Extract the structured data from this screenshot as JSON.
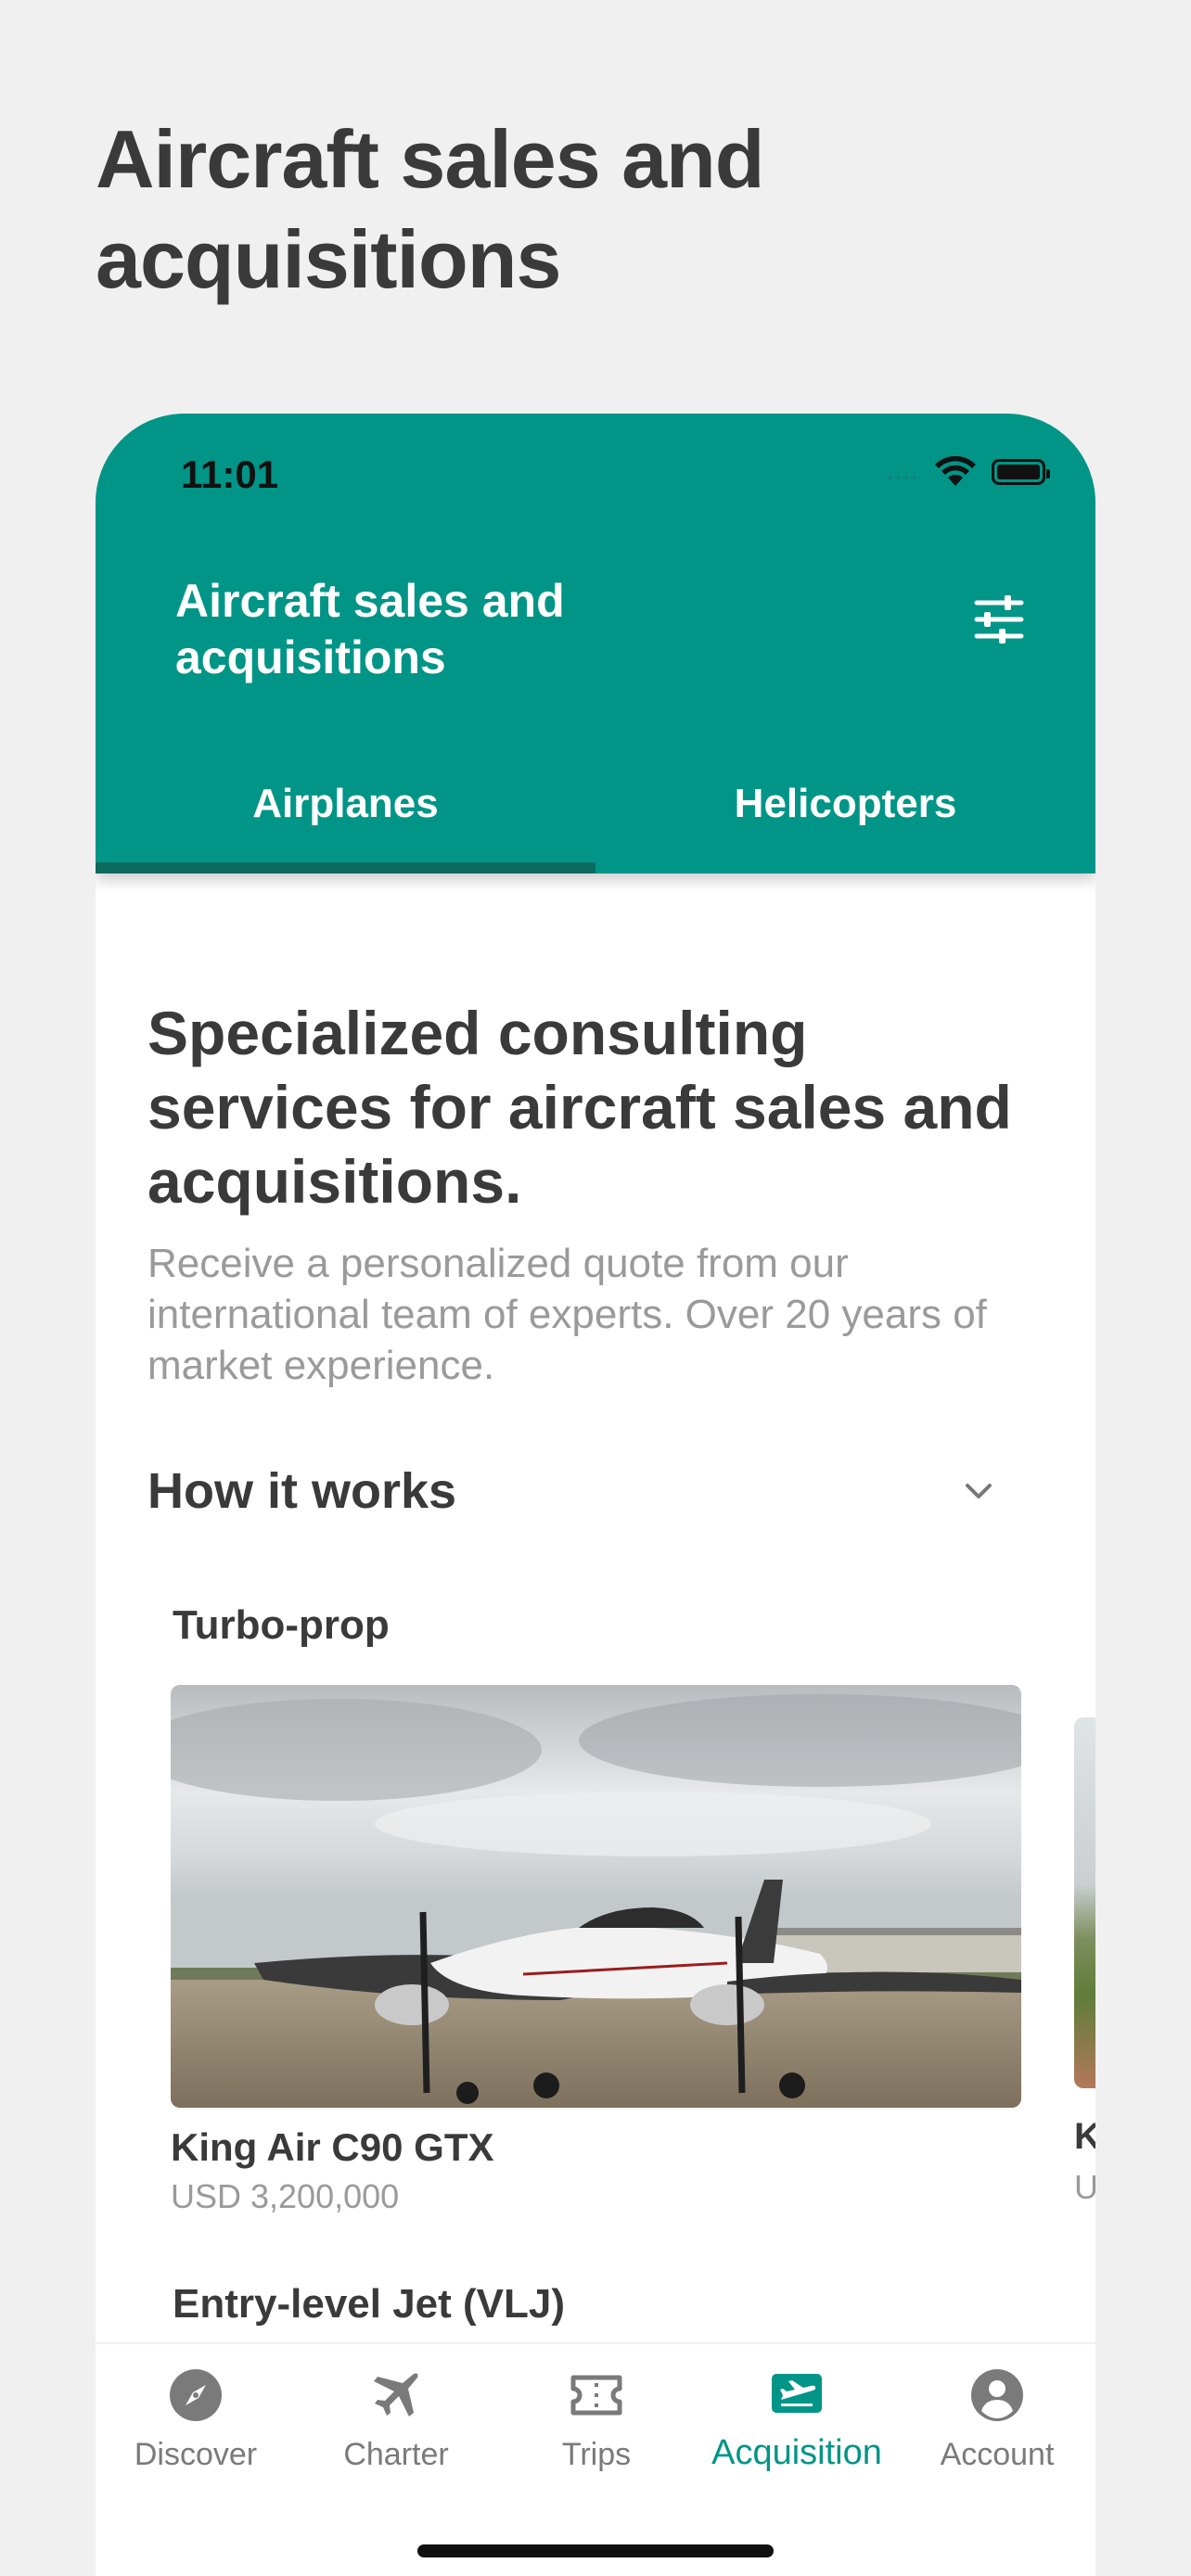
{
  "page_title": "Aircraft sales and acquisitions",
  "status_bar": {
    "time": "11:01",
    "signal": "....",
    "wifi_icon": "wifi-icon",
    "battery_icon": "battery-icon"
  },
  "header": {
    "title": "Aircraft sales and acquisitions",
    "filter_icon": "sliders-icon",
    "bg_color": "#009587",
    "tabs": [
      {
        "label": "Airplanes",
        "selected": true
      },
      {
        "label": "Helicopters",
        "selected": false
      }
    ]
  },
  "intro": {
    "headline": "Specialized consulting services for aircraft sales and acquisitions.",
    "description": "Receive a personalized quote from our international team of experts. Over 20 years of market experience."
  },
  "how_it_works": {
    "label": "How it works",
    "expanded": false
  },
  "sections": [
    {
      "title": "Turbo-prop",
      "items": [
        {
          "name": "King Air C90 GTX",
          "price": "USD 3,200,000"
        },
        {
          "name": "K",
          "price": "U"
        }
      ]
    },
    {
      "title": "Entry-level Jet (VLJ)",
      "items": []
    }
  ],
  "tab_bar": {
    "items": [
      {
        "label": "Discover",
        "icon": "compass-icon",
        "active": false
      },
      {
        "label": "Charter",
        "icon": "airplane-icon",
        "active": false
      },
      {
        "label": "Trips",
        "icon": "ticket-icon",
        "active": false
      },
      {
        "label": "Acquisition",
        "icon": "departure-icon",
        "active": true
      },
      {
        "label": "Account",
        "icon": "user-icon",
        "active": false
      }
    ]
  },
  "colors": {
    "accent": "#009587",
    "indicator": "#0e6b60",
    "inactive": "#7a7a7a",
    "background": "#f0f0f0"
  }
}
